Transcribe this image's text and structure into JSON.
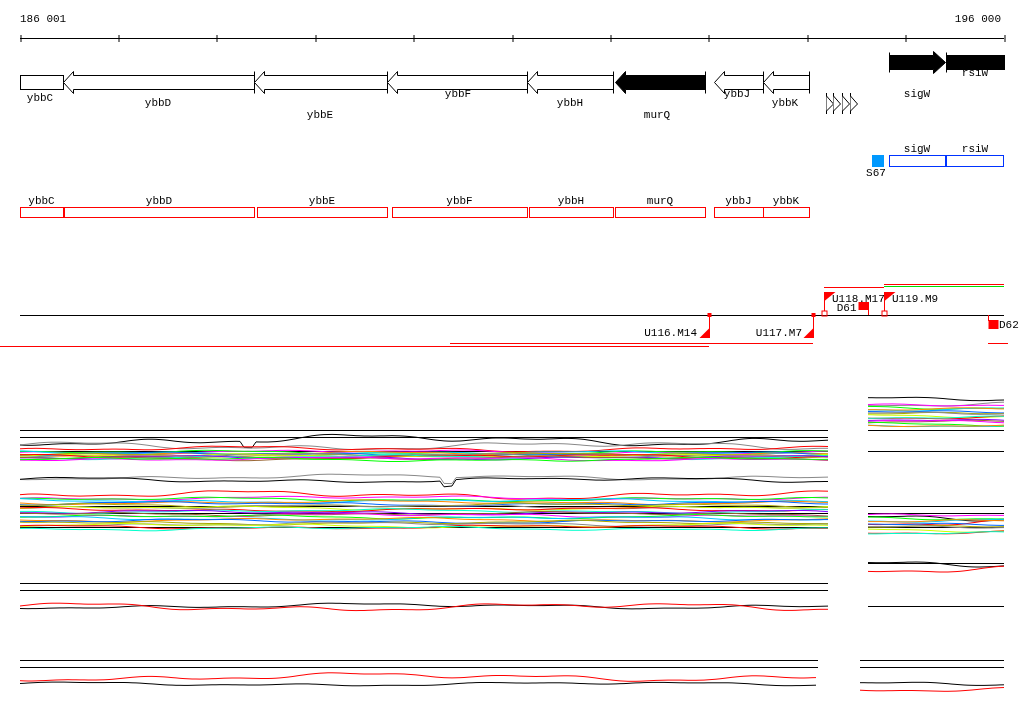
{
  "ruler": {
    "start_label": "186 001",
    "end_label": "196 000"
  },
  "genes": [
    {
      "label": "ybbC",
      "kind": "box",
      "highlighted": false
    },
    {
      "label": "ybbD",
      "kind": "reverse",
      "highlighted": false
    },
    {
      "label": "ybbE",
      "kind": "reverse",
      "highlighted": false
    },
    {
      "label": "ybbF",
      "kind": "reverse",
      "highlighted": false
    },
    {
      "label": "ybbH",
      "kind": "reverse",
      "highlighted": false
    },
    {
      "label": "murQ",
      "kind": "reverse",
      "highlighted": true
    },
    {
      "label": "ybbJ",
      "kind": "reverse",
      "highlighted": false
    },
    {
      "label": "ybbK",
      "kind": "reverse",
      "highlighted": false
    },
    {
      "label": "sigW",
      "kind": "forward",
      "highlighted": true
    },
    {
      "label": "rsiW",
      "kind": "box",
      "highlighted": true
    }
  ],
  "regulon": [
    {
      "label": "S67",
      "kind": "site"
    },
    {
      "label": "sigW",
      "kind": "gene"
    },
    {
      "label": "rsiW",
      "kind": "gene"
    }
  ],
  "operon_genes": [
    {
      "label": "ybbC"
    },
    {
      "label": "ybbD"
    },
    {
      "label": "ybbE"
    },
    {
      "label": "ybbF"
    },
    {
      "label": "ybbH"
    },
    {
      "label": "murQ"
    },
    {
      "label": "ybbJ"
    },
    {
      "label": "ybbK"
    }
  ],
  "transcription_marks": [
    {
      "label": "U116.M14",
      "kind": "upstream"
    },
    {
      "label": "U117.M7",
      "kind": "upstream"
    },
    {
      "label": "U118.M17",
      "kind": "start"
    },
    {
      "label": "D61",
      "kind": "downstream-above"
    },
    {
      "label": "U119.M9",
      "kind": "start"
    },
    {
      "label": "D62",
      "kind": "downstream-below"
    }
  ]
}
